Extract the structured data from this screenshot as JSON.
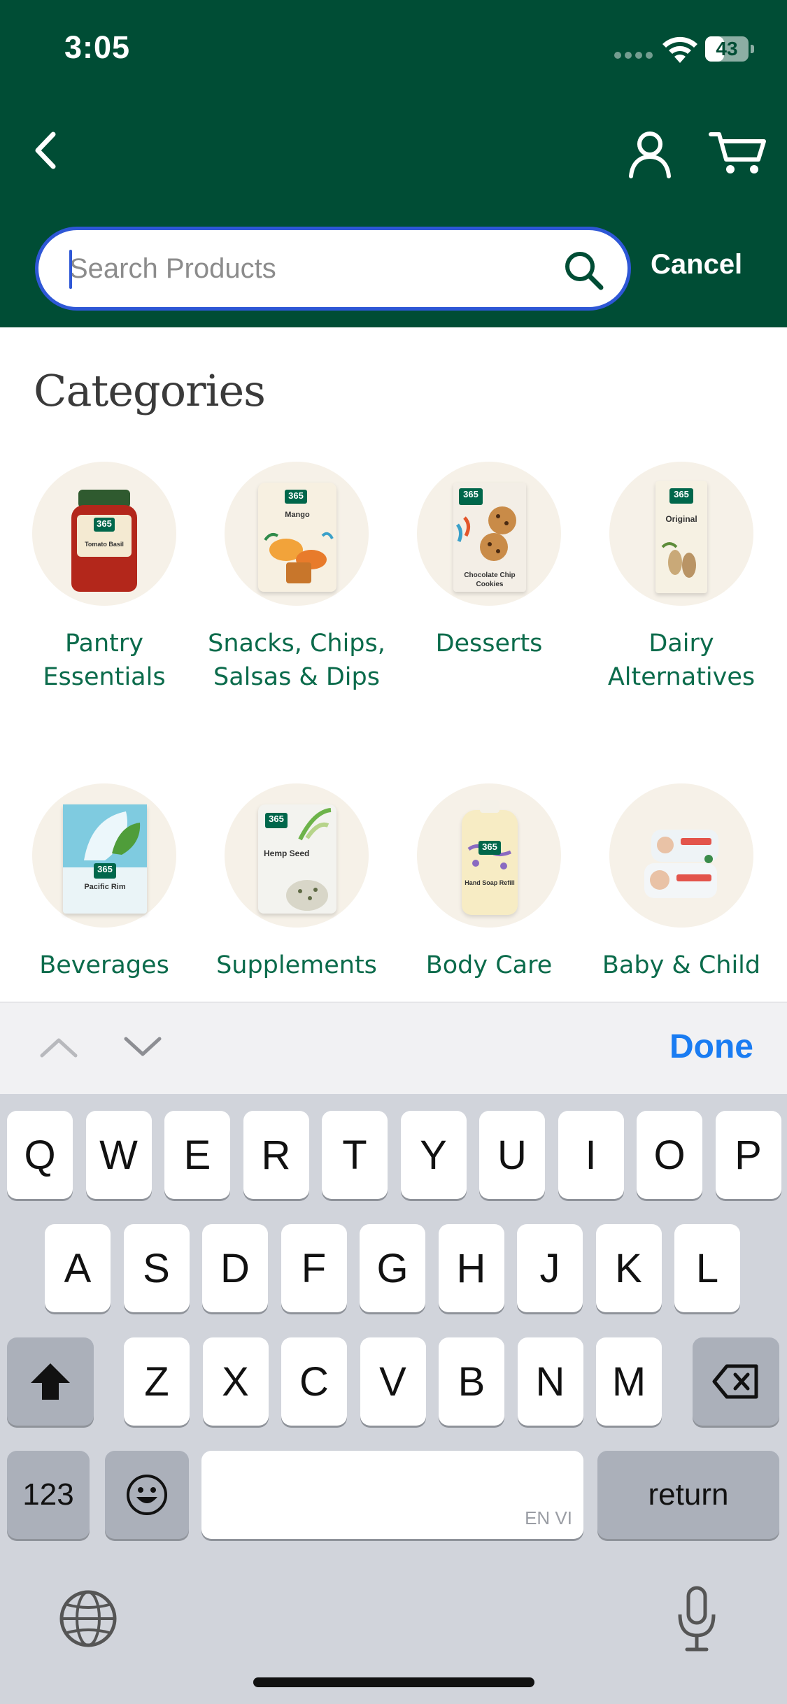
{
  "status_bar": {
    "time": "3:05",
    "battery": "43",
    "battery_level": 0.43
  },
  "header": {
    "cancel_label": "Cancel"
  },
  "search": {
    "placeholder": "Search Products",
    "value": ""
  },
  "categories": {
    "title": "Categories",
    "items": [
      {
        "label": "Pantry Essentials",
        "product": "365 Organic Tomato Basil Pasta Sauce",
        "product_caption": "Tomato Basil"
      },
      {
        "label": "Snacks, Chips, Salsas & Dips",
        "product": "365 Organic Mango",
        "product_caption": "Mango"
      },
      {
        "label": "Desserts",
        "product": "365 Organic Chocolate Chip Cookies",
        "product_caption": "Chocolate Chip Cookies"
      },
      {
        "label": "Dairy Alternatives",
        "product": "365 Organic Original Almondmilk",
        "product_caption": "Original"
      },
      {
        "label": "Beverages",
        "product": "365 Organic Pacific Rim",
        "product_caption": "Pacific Rim"
      },
      {
        "label": "Supplements",
        "product": "365 Organic Hemp Seed",
        "product_caption": "Hemp Seed"
      },
      {
        "label": "Body Care",
        "product": "365 Foaming Hand Soap Refill",
        "product_caption": "Hand Soap Refill"
      },
      {
        "label": "Baby & Child",
        "product": "365 Baby Wipes",
        "product_caption": ""
      }
    ]
  },
  "keyboard": {
    "done_label": "Done",
    "row1": [
      "Q",
      "W",
      "E",
      "R",
      "T",
      "Y",
      "U",
      "I",
      "O",
      "P"
    ],
    "row2": [
      "A",
      "S",
      "D",
      "F",
      "G",
      "H",
      "J",
      "K",
      "L"
    ],
    "row3": [
      "Z",
      "X",
      "C",
      "V",
      "B",
      "N",
      "M"
    ],
    "numbers_label": "123",
    "return_label": "return",
    "space_hint": "EN VI"
  },
  "colors": {
    "header_bg": "#004d35",
    "accent_green": "#0b6b4b",
    "focus_blue": "#2e57d6",
    "done_blue": "#1a7cf2"
  },
  "icons": [
    "back-chevron-icon",
    "account-icon",
    "cart-icon",
    "search-icon",
    "chevron-up-icon",
    "chevron-down-icon",
    "shift-icon",
    "delete-icon",
    "emoji-icon",
    "globe-icon",
    "microphone-icon"
  ]
}
